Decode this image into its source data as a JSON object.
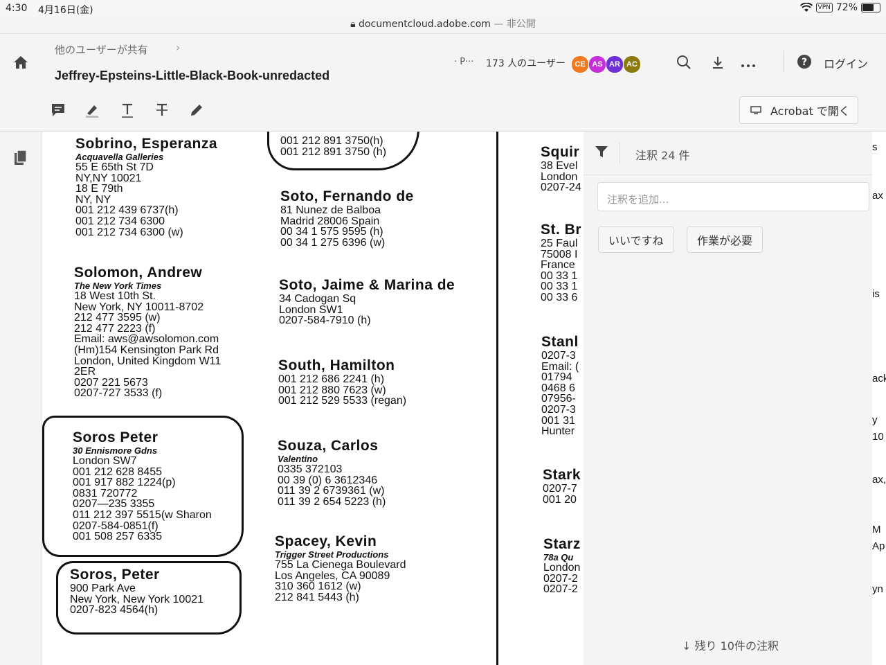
{
  "status_bar": {
    "time": "4:30",
    "date": "4月16日(金)",
    "url": "documentcloud.adobe.com",
    "url_suffix": " — 非公開",
    "vpn": "VPN",
    "battery": "72%"
  },
  "header": {
    "breadcrumb": "他のユーザーが共有",
    "title": "Jeffrey-Epsteins-Little-Black-Book-unredacted",
    "share_prefix": "· P···",
    "share_count": "173 人のユーザー",
    "avatars": [
      {
        "initials": "CE",
        "color": "#f07a22"
      },
      {
        "initials": "AS",
        "color": "#c62fd9"
      },
      {
        "initials": "AR",
        "color": "#6e2fd6"
      },
      {
        "initials": "AC",
        "color": "#8a7a10"
      }
    ],
    "login": "ログイン"
  },
  "toolbar": {
    "acrobat_button": "Acrobat で開く"
  },
  "panel": {
    "count_label": "注釈 24 件",
    "input_placeholder": "注釈を追加...",
    "like_button": "いいですね",
    "action_button": "作業が必要",
    "remaining": "残り 10件の注釈"
  },
  "document": {
    "col1": [
      {
        "name": "Sobrino, Esperanza",
        "company": "Acquavella Galleries",
        "lines": [
          "55 E 65th St 7D",
          "NY,NY 10021",
          "18 E 79th",
          "NY, NY",
          "001 212 439 6737(h)",
          "001 212 734 6300",
          "001 212 734 6300 (w)"
        ]
      },
      {
        "name": "Solomon, Andrew",
        "company": "The New York Times",
        "lines": [
          "18 West 10th St.",
          "New York, NY 10011-8702",
          "212 477 3595 (w)",
          "212 477 2223 (f)",
          "Email: aws@awsolomon.com",
          "(Hm)154 Kensington Park Rd",
          "London, United Kingdom W11",
          "2ER",
          "0207 221 5673",
          "0207-727 3533 (f)"
        ]
      },
      {
        "name": "Soros Peter",
        "company": "30 Ennismore Gdns",
        "lines": [
          "London SW7",
          "001 212 628 8455",
          " 001 917 882 1224(p)",
          "0831 720772",
          " 0207—235 3355",
          "011 212 397 5515(w Sharon",
          "0207-584-0851(f)",
          " 001 508 257 6335"
        ]
      },
      {
        "name": "Soros, Peter",
        "company": "",
        "lines": [
          "900 Park Ave",
          "New York, New York  10021",
          "0207-823 4564(h)"
        ]
      }
    ],
    "col2": [
      {
        "name": "",
        "company": "",
        "lines": [
          "001 212 891 3750(h)",
          "001 212 891 3750 (h)"
        ]
      },
      {
        "name": "Soto, Fernando de",
        "company": "",
        "lines": [
          "81 Nunez de Balboa",
          "Madrid 28006 Spain",
          "00 34 1 575 9595 (h)",
          "00 34 1 275 6396 (w)"
        ]
      },
      {
        "name": "Soto, Jaime & Marina de",
        "company": "",
        "lines": [
          "34 Cadogan Sq",
          "London  SW1",
          "0207-584-7910 (h)"
        ]
      },
      {
        "name": "South, Hamilton",
        "company": "",
        "lines": [
          "001 212 686 2241 (h)",
          "001 212 880 7623 (w)",
          "001 212 529 5533 (regan)"
        ]
      },
      {
        "name": "Souza, Carlos",
        "company": "Valentino",
        "lines": [
          "0335 372103",
          "00 39 (0) 6 3612346",
          "011 39 2 6739361 (w)",
          "011 39 2 654 5223 (h)"
        ]
      },
      {
        "name": "Spacey, Kevin",
        "company": "Trigger Street Productions",
        "lines": [
          "755 La Cienega Boulevard",
          "Los Angeles, CA 90089",
          "310 360 1612 (w)",
          "212 841 5443 (h)"
        ]
      }
    ],
    "col3": [
      {
        "name": "Squir",
        "company": "",
        "lines": [
          "38 Evel",
          "London",
          "0207-24"
        ]
      },
      {
        "name": "St. Br",
        "company": "",
        "lines": [
          "25 Faul",
          "75008 I",
          "France",
          "00 33 1",
          "00 33 1",
          "00 33 6"
        ]
      },
      {
        "name": "Stanl",
        "company": "",
        "lines": [
          "0207-3",
          "Email: (",
          "01794 ",
          "0468 6",
          "07956-",
          "0207-3",
          "001 31",
          "Hunter"
        ]
      },
      {
        "name": "Stark",
        "company": "",
        "lines": [
          "0207-7",
          "001 20"
        ]
      },
      {
        "name": "Starz",
        "company": "78a Qu",
        "lines": [
          "London",
          "0207-2",
          "0207-2"
        ]
      }
    ],
    "right_strip": [
      "s",
      "ax",
      "is",
      "ack",
      "y",
      "10",
      "ax,c",
      "M",
      "Ap",
      "yn"
    ]
  }
}
